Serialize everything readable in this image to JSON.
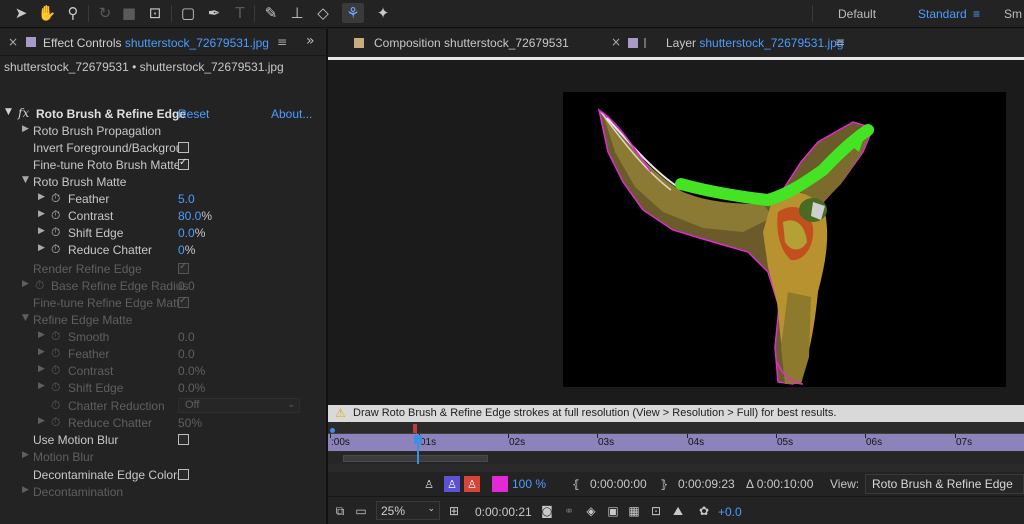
{
  "workspaces": {
    "default": "Default",
    "standard": "Standard",
    "small_screen": "Sm"
  },
  "effect_panel": {
    "tab_prefix": "Effect Controls",
    "tab_file": "shutterstock_72679531.jpg",
    "layer_path": "shutterstock_72679531 • shutterstock_72679531.jpg",
    "effect_name": "Roto Brush & Refine Edge",
    "reset": "Reset",
    "about": "About...",
    "rows": {
      "propagation": "Roto Brush Propagation",
      "invert": "Invert Foreground/Backgrou",
      "finetune_roto": "Fine-tune Roto Brush Matte",
      "roto_matte": "Roto Brush Matte",
      "feather": "Feather",
      "feather_val": "5.0",
      "contrast": "Contrast",
      "contrast_val": "80.0",
      "shift_edge": "Shift Edge",
      "shift_edge_val": "0.0",
      "reduce_chatter": "Reduce Chatter",
      "reduce_chatter_val": "0",
      "percent": "%",
      "render_refine": "Render Refine Edge",
      "base_radius": "Base Refine Edge Radius",
      "base_radius_val": "0.0",
      "finetune_refine": "Fine-tune Refine Edge Matte",
      "refine_matte": "Refine Edge Matte",
      "smooth": "Smooth",
      "smooth_val": "0.0",
      "feather2": "Feather",
      "feather2_val": "0.0",
      "contrast2": "Contrast",
      "contrast2_val": "0.0%",
      "shift_edge2": "Shift Edge",
      "shift_edge2_val": "0.0%",
      "chatter_reduction": "Chatter Reduction",
      "chatter_reduction_val": "Off",
      "reduce_chatter2": "Reduce Chatter",
      "reduce_chatter2_val": "50%",
      "motion_blur_use": "Use Motion Blur",
      "motion_blur": "Motion Blur",
      "decontaminate": "Decontaminate Edge Colors",
      "decontamination": "Decontamination"
    }
  },
  "viewer_panel": {
    "comp_tab": "Composition shutterstock_72679531",
    "layer_tab_prefix": "Layer",
    "layer_tab_file": "shutterstock_72679531.jpg",
    "warning": "Draw Roto Brush & Refine Edge strokes at full resolution (View > Resolution > Full) for best results.",
    "ruler_ticks": [
      ":00s",
      "01s",
      "02s",
      "03s",
      "04s",
      "05s",
      "06s",
      "07s"
    ],
    "resolution": "100 %",
    "in_time": "0:00:00:00",
    "out_time": "0:00:09:23",
    "duration": "Δ 0:00:10:00",
    "view_label": "View:",
    "view_value": "Roto Brush & Refine Edge",
    "zoom": "25%",
    "current_time": "0:00:00:21",
    "exposure": "+0.0"
  },
  "colors": {
    "accent_blue": "#4c9cff",
    "stroke_green": "#44e324",
    "outline_magenta": "#e12ad6"
  }
}
